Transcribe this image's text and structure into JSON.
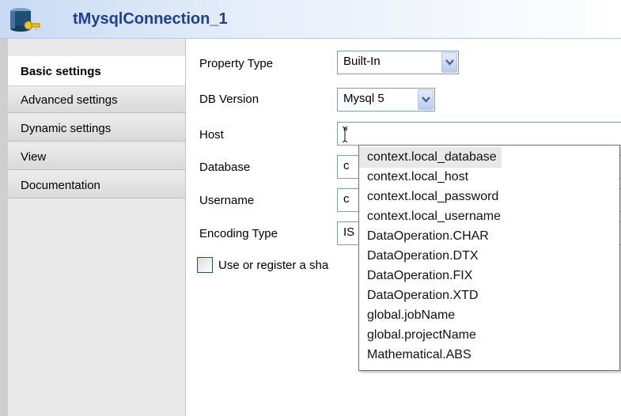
{
  "title": "tMysqlConnection_1",
  "tabs": [
    {
      "label": "Basic settings"
    },
    {
      "label": "Advanced settings"
    },
    {
      "label": "Dynamic settings"
    },
    {
      "label": "View"
    },
    {
      "label": "Documentation"
    }
  ],
  "form": {
    "property_type_label": "Property Type",
    "property_type_value": "Built-In",
    "db_version_label": "DB Version",
    "db_version_value": "Mysql 5",
    "host_label": "Host",
    "host_value": "\"",
    "database_label": "Database",
    "database_value": "c",
    "username_label": "Username",
    "username_value": "c",
    "encoding_label": "Encoding Type",
    "encoding_value": "IS",
    "shared_label": "Use or register a sha"
  },
  "autocomplete": {
    "items": [
      "context.local_database",
      "context.local_host",
      "context.local_password",
      "context.local_username",
      "DataOperation.CHAR",
      "DataOperation.DTX",
      "DataOperation.FIX",
      "DataOperation.XTD",
      "global.jobName",
      "global.projectName",
      "Mathematical.ABS"
    ],
    "selected_index": 0
  },
  "icons": {
    "component": "mysql-connection-icon",
    "dropdown": "chevron-down-icon"
  },
  "colors": {
    "title": "#1f3f8f",
    "accent": "#7f9db9"
  }
}
